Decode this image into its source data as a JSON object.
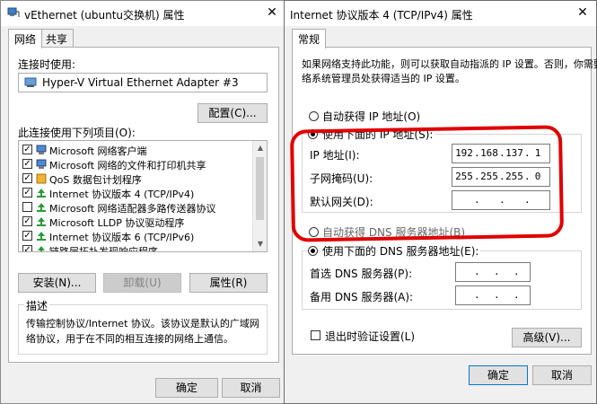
{
  "left_window": {
    "title": "vEthernet (ubuntu交换机) 属性",
    "tabs": [
      {
        "label": "网络"
      },
      {
        "label": "共享"
      }
    ],
    "connect_using_label": "连接时使用:",
    "adapter_name": "Hyper-V Virtual Ethernet Adapter #3",
    "configure_button": "配置(C)...",
    "items_label": "此连接使用下列项目(O):",
    "items": [
      {
        "label": "Microsoft 网络客户端",
        "checked": true,
        "icon": "network-client-icon"
      },
      {
        "label": "Microsoft 网络的文件和打印机共享",
        "checked": true,
        "icon": "file-share-icon"
      },
      {
        "label": "QoS 数据包计划程序",
        "checked": true,
        "icon": "qos-icon"
      },
      {
        "label": "Internet 协议版本 4 (TCP/IPv4)",
        "checked": true,
        "icon": "protocol-icon"
      },
      {
        "label": "Microsoft 网络适配器多路传送器协议",
        "checked": false,
        "icon": "protocol-icon"
      },
      {
        "label": "Microsoft LLDP 协议驱动程序",
        "checked": true,
        "icon": "protocol-icon"
      },
      {
        "label": "Internet 协议版本 6 (TCP/IPv6)",
        "checked": true,
        "icon": "protocol-icon"
      },
      {
        "label": "链路层拓扑发现响应程序",
        "checked": true,
        "icon": "protocol-icon"
      }
    ],
    "install_button": "安装(N)...",
    "uninstall_button": "卸载(U)",
    "properties_button": "属性(R)",
    "description_title": "描述",
    "description_text": "传输控制协议/Internet 协议。该协议是默认的广域网络协议，用于在不同的相互连接的网络上通信。",
    "ok_button": "确定",
    "cancel_button": "取消"
  },
  "right_window": {
    "title": "Internet 协议版本 4 (TCP/IPv4) 属性",
    "tabs": [
      {
        "label": "常规"
      }
    ],
    "intro_text_line1": "如果网络支持此功能，则可以获取自动指派的 IP 设置。否则，你需要从网",
    "intro_text_line2": "络系统管理员处获得适当的 IP 设置。",
    "auto_ip_label": "自动获得 IP 地址(O)",
    "manual_ip_label": "使用下面的 IP 地址(S):",
    "ip_address_label": "IP 地址(I):",
    "subnet_mask_label": "子网掩码(U):",
    "gateway_label": "默认网关(D):",
    "ip_address": [
      "192",
      "168",
      "137",
      "1"
    ],
    "subnet_mask": [
      "255",
      "255",
      "255",
      "0"
    ],
    "gateway": [
      "",
      "",
      "",
      ""
    ],
    "auto_dns_label": "自动获得 DNS 服务器地址(B)",
    "manual_dns_label": "使用下面的 DNS 服务器地址(E):",
    "preferred_dns_label": "首选 DNS 服务器(P):",
    "alternate_dns_label": "备用 DNS 服务器(A):",
    "preferred_dns": [
      "",
      "",
      "",
      ""
    ],
    "alternate_dns": [
      "",
      "",
      "",
      ""
    ],
    "validate_on_exit_label": "退出时验证设置(L)",
    "advanced_button": "高级(V)...",
    "ok_button": "确定",
    "cancel_button": "取消",
    "auto_ip_selected": false,
    "manual_ip_selected": true,
    "auto_dns_selected": false,
    "manual_dns_selected": true,
    "validate_on_exit_checked": false
  },
  "colors": {
    "annotation_red": "#e00000",
    "focus_blue": "#0078d7",
    "window_bg": "#f0f0f0"
  }
}
